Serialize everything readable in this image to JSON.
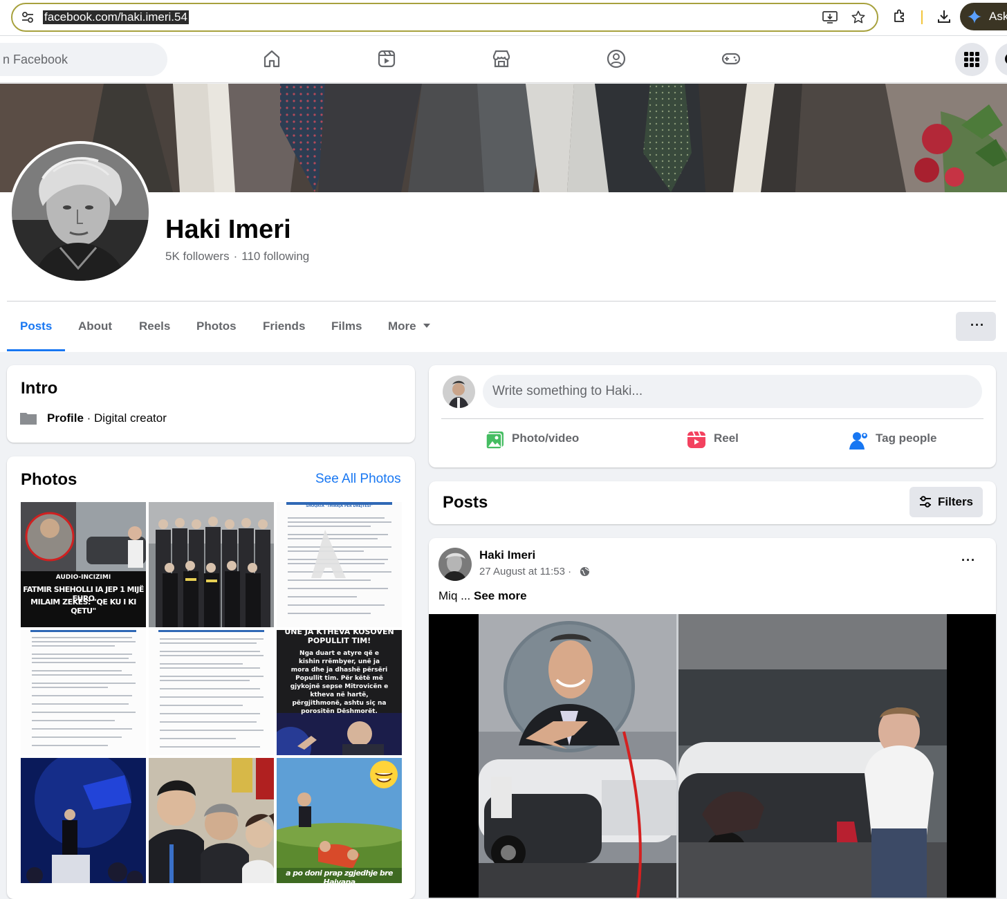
{
  "browser": {
    "url": "facebook.com/haki.imeri.54",
    "ask_label": "Ask"
  },
  "topnav": {
    "search_placeholder": "Search Facebook",
    "search_visible": "n Facebook",
    "icons": [
      "home-icon",
      "video-icon",
      "marketplace-icon",
      "groups-icon",
      "gaming-icon",
      "menu-grid-icon",
      "messenger-icon"
    ]
  },
  "profile": {
    "name": "Haki Imeri",
    "followers": "5K followers",
    "following": "110 following",
    "separator": "·"
  },
  "tabs": [
    "Posts",
    "About",
    "Reels",
    "Photos",
    "Friends",
    "Films",
    "More"
  ],
  "tab_menu_label": "···",
  "intro": {
    "title": "Intro",
    "category_bold": "Profile",
    "category_rest": " · Digital creator"
  },
  "photos": {
    "title": "Photos",
    "see_all": "See All Photos",
    "captions": {
      "p1_line1": "AUDIO-INCIZIMI",
      "p1_line2": "FATMIR SHEHOLLI IA JEP 1 MIJË EURO",
      "p1_line3": "MILAIM ZEKËS: \"QE KU I KI QETU\"",
      "p3_heading": "SHOQATA \"THIRRJA PËR DREJTËSI\"",
      "p6_heading": "UNË JA KTHEVA KOSOVËN POPULLIT TIM!",
      "p6_body": "Nga duart e atyre që e kishin rrëmbyer, unë ja mora dhe ja dhashë përsëri Popullit tim. Për këtë më gjykojnë sepse Mitrovicën e ktheva në hartë, përgjithmonë, ashtu siç na porositën Dëshmorët.",
      "p9_caption": "a po doni prap zgjedhje bre Hajvana"
    }
  },
  "composer": {
    "placeholder": "Write something to Haki...",
    "actions": [
      "Photo/video",
      "Reel",
      "Tag people"
    ]
  },
  "posts_header": {
    "title": "Posts",
    "filters": "Filters"
  },
  "post": {
    "author": "Haki Imeri",
    "date": "27 August at 11:53 ·",
    "text_prefix": "Miq ... ",
    "see_more": "See more",
    "menu": "···"
  },
  "colors": {
    "accent": "#1877f2",
    "background": "#f0f2f5",
    "url_border": "#a7a13d",
    "ask_button": "#3b3524"
  }
}
